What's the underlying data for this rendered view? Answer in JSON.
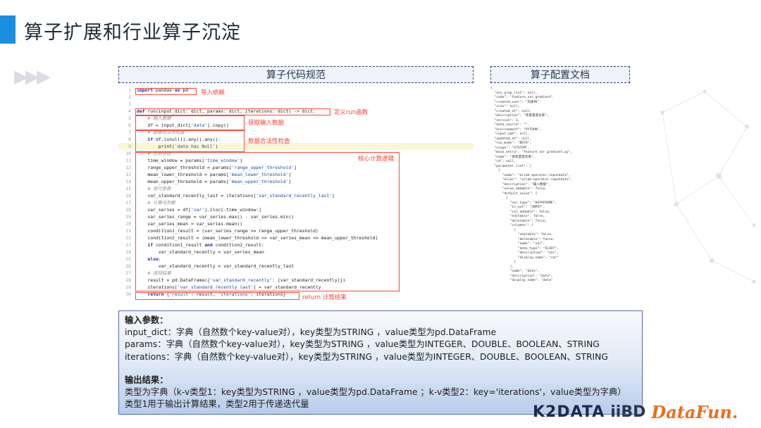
{
  "slide_title": "算子扩展和行业算子沉淀",
  "code_header": "算子代码规范",
  "config_header": "算子配置文档",
  "code_lines": [
    {
      "n": "1",
      "segs": [
        {
          "t": "import",
          "c": "kw"
        },
        {
          "t": " pandas "
        },
        {
          "t": "as",
          "c": "kw"
        },
        {
          "t": " pd"
        }
      ]
    },
    {
      "n": "2",
      "segs": []
    },
    {
      "n": "3",
      "segs": []
    },
    {
      "n": "4",
      "segs": [
        {
          "t": "def",
          "c": "kw"
        },
        {
          "t": " run(input_dict: dict, params: dict, iterations: dict) -> dict:"
        }
      ]
    },
    {
      "n": "5",
      "segs": [
        {
          "t": "    # 输入数据",
          "c": "cm"
        }
      ]
    },
    {
      "n": "6",
      "segs": [
        {
          "t": "    df = input_dict["
        },
        {
          "t": "'data'",
          "c": "str"
        },
        {
          "t": "].copy()"
        }
      ]
    },
    {
      "n": "7",
      "segs": [
        {
          "t": "    # 数据合法性检查",
          "c": "cm"
        }
      ]
    },
    {
      "n": "8",
      "segs": [
        {
          "t": "    "
        },
        {
          "t": "if",
          "c": "kw"
        },
        {
          "t": " df.isnull().any().any():"
        }
      ]
    },
    {
      "n": "9",
      "segs": [
        {
          "t": "        print("
        },
        {
          "t": "'data has Null'",
          "c": "str"
        },
        {
          "t": ")"
        }
      ],
      "hl": true
    },
    {
      "n": "10",
      "segs": [
        {
          "t": "    # 控制参数",
          "c": "cm"
        }
      ]
    },
    {
      "n": "11",
      "segs": [
        {
          "t": "    time_window = params["
        },
        {
          "t": "'time_window'",
          "c": "str"
        },
        {
          "t": "]"
        }
      ]
    },
    {
      "n": "12",
      "segs": [
        {
          "t": "    range_upper_threshold = params["
        },
        {
          "t": "'range_upper_threshold'",
          "c": "str"
        },
        {
          "t": "]"
        }
      ]
    },
    {
      "n": "13",
      "segs": [
        {
          "t": "    mean_lower_threshold = params["
        },
        {
          "t": "'mean_lower_threshold'",
          "c": "str"
        },
        {
          "t": "]"
        }
      ]
    },
    {
      "n": "14",
      "segs": [
        {
          "t": "    mean_upper_threshold = params["
        },
        {
          "t": "'mean_upper_threshold'",
          "c": "str"
        },
        {
          "t": "]"
        }
      ]
    },
    {
      "n": "15",
      "segs": [
        {
          "t": "    # 迭代参数",
          "c": "cm"
        }
      ]
    },
    {
      "n": "16",
      "segs": [
        {
          "t": "    var_standard_recently_last = iterations["
        },
        {
          "t": "'var_standard_recently_last'",
          "c": "str"
        },
        {
          "t": "]"
        }
      ]
    },
    {
      "n": "17",
      "segs": [
        {
          "t": "    # 计算与判断",
          "c": "cm"
        }
      ]
    },
    {
      "n": "18",
      "segs": [
        {
          "t": "    var_series = df["
        },
        {
          "t": "'var'",
          "c": "str"
        },
        {
          "t": "].iloc[-time_window:]"
        }
      ]
    },
    {
      "n": "19",
      "segs": [
        {
          "t": "    var_series_range = var_series.max() - var_series.min()"
        }
      ]
    },
    {
      "n": "20",
      "segs": [
        {
          "t": "    var_series_mean = var_series.mean()"
        }
      ]
    },
    {
      "n": "21",
      "segs": [
        {
          "t": "    condition1_result = (var_series_range <= range_upper_threshold)"
        }
      ]
    },
    {
      "n": "22",
      "segs": [
        {
          "t": "    condition2_result = (mean_lower_threshold <= var_series_mean <= mean_upper_threshold)"
        }
      ]
    },
    {
      "n": "23",
      "segs": [
        {
          "t": "    "
        },
        {
          "t": "if",
          "c": "kw"
        },
        {
          "t": " condition1_result "
        },
        {
          "t": "and",
          "c": "kw"
        },
        {
          "t": " condition2_result:"
        }
      ]
    },
    {
      "n": "24",
      "segs": [
        {
          "t": "        var_standard_recently = var_series_mean"
        }
      ]
    },
    {
      "n": "25",
      "segs": [
        {
          "t": "    "
        },
        {
          "t": "else",
          "c": "kw"
        },
        {
          "t": ":"
        }
      ]
    },
    {
      "n": "26",
      "segs": [
        {
          "t": "        var_standard_recently = var_standard_recently_last"
        }
      ]
    },
    {
      "n": "27",
      "segs": [
        {
          "t": "    # 返回结果",
          "c": "cm"
        }
      ]
    },
    {
      "n": "28",
      "segs": [
        {
          "t": "    result = pd.DataFrame({"
        },
        {
          "t": "'var_standard_recently'",
          "c": "str"
        },
        {
          "t": ": [var_standard_recently]})"
        }
      ]
    },
    {
      "n": "29",
      "segs": [
        {
          "t": "    iterations["
        },
        {
          "t": "'var_standard_recently_last'",
          "c": "str"
        },
        {
          "t": "] = var_standard_recently"
        }
      ]
    },
    {
      "n": "30",
      "segs": [
        {
          "t": "    "
        },
        {
          "t": "return",
          "c": "kw"
        },
        {
          "t": " {"
        },
        {
          "t": "'result'",
          "c": "str"
        },
        {
          "t": ": result, "
        },
        {
          "t": "'iterations'",
          "c": "str"
        },
        {
          "t": ": iterations}"
        }
      ]
    }
  ],
  "annotations": {
    "import": "导入依赖",
    "def": "定义run函数",
    "input": "获取输入数据",
    "check": "数据合法性检查",
    "core": "核心计算逻辑",
    "ret": "return 计算结果"
  },
  "config_lines": [
    "{",
    "  \"env_prop_list\": null,",
    "  \"code\": \"feature_var_gradient\",",
    "  \"created_user\": \"刘家林\",",
    "  \"icon\": null,",
    "  \"created_at\": null,",
    "  \"description\": \"单变量变化率\",",
    "  \"version\": 1,",
    "  \"data_source\": \"\",",
    "  \"environment\": \"PYTHON\",",
    "  \"input_num\": null,",
    "  \"updated_at\": null,",
    "  \"run_mode\": \"BOTH\",",
    "  \"scope\": \"SYSTEM\",",
    "  \"main_entry\": \"feature_var_gradient.py\",",
    "  \"name\": \"单变量变化率\",",
    "  \"id\": null,",
    "  \"parameter_list\": [",
    "    {",
    "      \"name\": \"oilab-operator-inputdata\",",
    "      \"alias\": \"oilab-operator-inputdata\",",
    "      \"description\": \"输入数据\",",
    "      \"value_addable\": false,",
    "      \"default_value\": {",
    "        {",
    "          \"var_type\": \"DATAFRAME\",",
    "          \"in_out\": \"INPUT\",",
    "          \"col_addable\": false,",
    "          \"editable\": false,",
    "          \"deletable\": false,",
    "          \"columns\": [",
    "            {",
    "              \"editable\": false,",
    "              \"deletable\": false,",
    "              \"name\": \"var\",",
    "              \"data_type\": \"FLOAT\",",
    "              \"description\": \"var\",",
    "              \"display_name\": \"var\"",
    "            }",
    "          ],",
    "          \"name\": \"data\",",
    "          \"description\": \"data\",",
    "          \"display_name\": \"data\""
  ],
  "info": {
    "input_heading": "输入参数：",
    "input_lines": [
      "input_dict：字典（自然数个key-value对），key类型为STRING ，value类型为pd.DataFrame",
      "params：字典（自然数个key-value对），key类型为STRING ，value类型为INTEGER、DOUBLE、BOOLEAN、STRING",
      "iterations：字典（自然数个key-value对），key类型为STRING ，value类型为INTEGER、DOUBLE、BOOLEAN、STRING"
    ],
    "output_heading": "输出结果：",
    "output_lines": [
      "类型为字典（k-v类型1：key类型为STRING ，value类型为pd.DataFrame ；k-v类型2：key='iterations'，value类型为字典）",
      "类型1用于输出计算结果，类型2用于传递迭代量"
    ]
  },
  "logos": {
    "k2data": "K2DATA",
    "iibd": "iiBD",
    "datafun": "DataFun."
  },
  "colors": {
    "accent": "#1a8fe0",
    "annotation": "#ff3d2e",
    "keyword": "#1a2a9a",
    "string": "#1a4ea0"
  }
}
